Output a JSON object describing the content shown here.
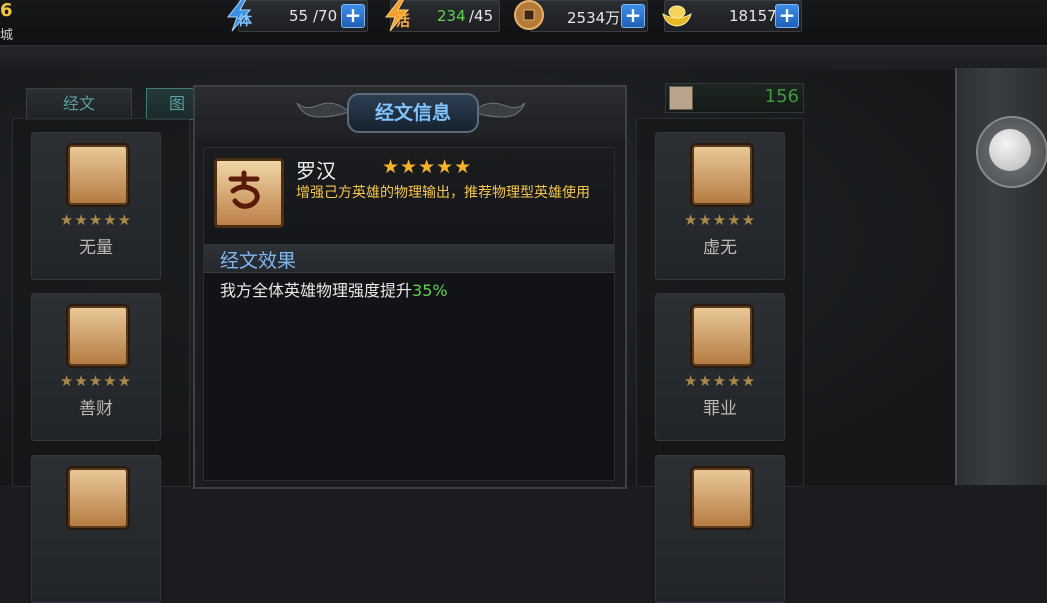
{
  "player": {
    "level": "6",
    "location": "城"
  },
  "resources": {
    "stamina": {
      "icon": "stamina-lightning-icon",
      "icon_label": "体",
      "current": "55",
      "max": "/70"
    },
    "vigor": {
      "icon": "vigor-lightning-icon",
      "icon_label": "活",
      "current": "234",
      "max": "/45"
    },
    "coins": {
      "icon": "copper-coin-icon",
      "value": "2534万"
    },
    "ingots": {
      "icon": "gold-ingot-icon",
      "value": "18157"
    },
    "plus_label": "+"
  },
  "tabs": [
    {
      "label": "经文"
    },
    {
      "label": "图"
    }
  ],
  "scripture_count": {
    "icon": "scroll-icon",
    "value": "156"
  },
  "cards_left": [
    {
      "name": "无量",
      "stars": "★★★★★"
    },
    {
      "name": "善财",
      "stars": "★★★★★"
    }
  ],
  "cards_right": [
    {
      "name": "虚无",
      "stars": "★★★★★"
    },
    {
      "name": "罪业",
      "stars": "★★★★★"
    }
  ],
  "dialog": {
    "title": "经文信息",
    "item": {
      "name": "罗汉",
      "stars": "★★★★★",
      "description": "增强己方英雄的物理输出，推荐物理型英雄使用"
    },
    "effect_header": "经文效果",
    "effect_text": "我方全体英雄物理强度提升",
    "effect_value": "35%"
  },
  "colors": {
    "title_blue": "#7fc3ff",
    "description_yellow": "#f4c64c",
    "effect_green": "#5fd24f",
    "star_gold": "#f6b327"
  }
}
